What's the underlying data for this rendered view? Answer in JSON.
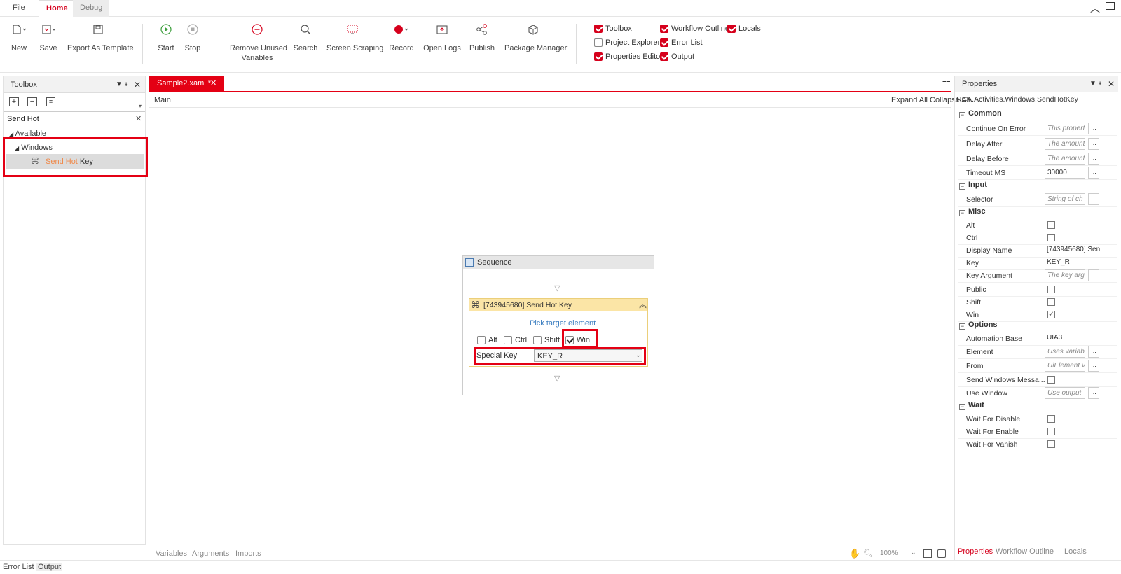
{
  "menu": {
    "file": "File",
    "home": "Home",
    "debug": "Debug"
  },
  "ribbon": {
    "new": "New",
    "save": "Save",
    "export": "Export As Template",
    "start": "Start",
    "stop": "Stop",
    "remove_line1": "Remove Unused",
    "remove_line2": "Variables",
    "search": "Search",
    "screen_scraping": "Screen Scraping",
    "record": "Record",
    "open_logs": "Open Logs",
    "publish": "Publish",
    "package_manager": "Package Manager",
    "toggles": {
      "toolbox": "Toolbox",
      "project_explorer": "Project Explorer",
      "properties_editor": "Properties Editor",
      "workflow_outline": "Workflow Outline",
      "error_list": "Error List",
      "output": "Output",
      "locals": "Locals"
    }
  },
  "colors": {
    "accent": "#e40014"
  },
  "toolbox": {
    "title": "Toolbox",
    "search_value": "Send Hot",
    "available": "Available",
    "category": "Windows",
    "item_match": "Send Hot",
    "item_rest": " Key"
  },
  "document": {
    "tab_label": "Sample2.xaml *",
    "breadcrumb": "Main",
    "expand_all": "Expand All",
    "collapse_all": "Collapse All"
  },
  "sequence": {
    "title": "Sequence",
    "activity_title": "[743945680] Send Hot Key",
    "pick_target": "Pick target element",
    "alt": "Alt",
    "ctrl": "Ctrl",
    "shift": "Shift",
    "win": "Win",
    "special_key_label": "Special Key",
    "special_key_value": "KEY_R"
  },
  "canvas_footer": {
    "variables": "Variables",
    "arguments": "Arguments",
    "imports": "Imports",
    "zoom": "100%"
  },
  "properties": {
    "title": "Properties",
    "type_name": "RCA.Activities.Windows.SendHotKey",
    "sections": {
      "common": "Common",
      "input": "Input",
      "misc": "Misc",
      "options": "Options",
      "wait": "Wait"
    },
    "continue_on_error": "Continue On Error",
    "continue_on_error_ph": "This propert",
    "delay_after": "Delay After",
    "delay_after_ph": "The amount",
    "delay_before": "Delay Before",
    "delay_before_ph": "The amount",
    "timeout": "Timeout MS",
    "timeout_val": "30000",
    "selector": "Selector",
    "selector_ph": "String of ch",
    "alt": "Alt",
    "ctrl": "Ctrl",
    "display_name": "Display Name",
    "display_name_val": "[743945680] Sen",
    "key": "Key",
    "key_val": "KEY_R",
    "key_argument": "Key Argument",
    "key_argument_ph": "The key arg",
    "public": "Public",
    "shift": "Shift",
    "win": "Win",
    "automation_base": "Automation Base",
    "automation_base_val": "UIA3",
    "element": "Element",
    "element_ph": "Uses variab",
    "from": "From",
    "from_ph": "UiElement v",
    "send_windows_messages": "Send Windows Messa...",
    "use_window": "Use Window",
    "use_window_ph": "Use output",
    "wait_disable": "Wait For Disable",
    "wait_enable": "Wait For Enable",
    "wait_vanish": "Wait For Vanish",
    "tabs": {
      "properties": "Properties",
      "workflow_outline": "Workflow Outline",
      "locals": "Locals"
    }
  },
  "bottom": {
    "error_list": "Error List",
    "output": "Output"
  }
}
